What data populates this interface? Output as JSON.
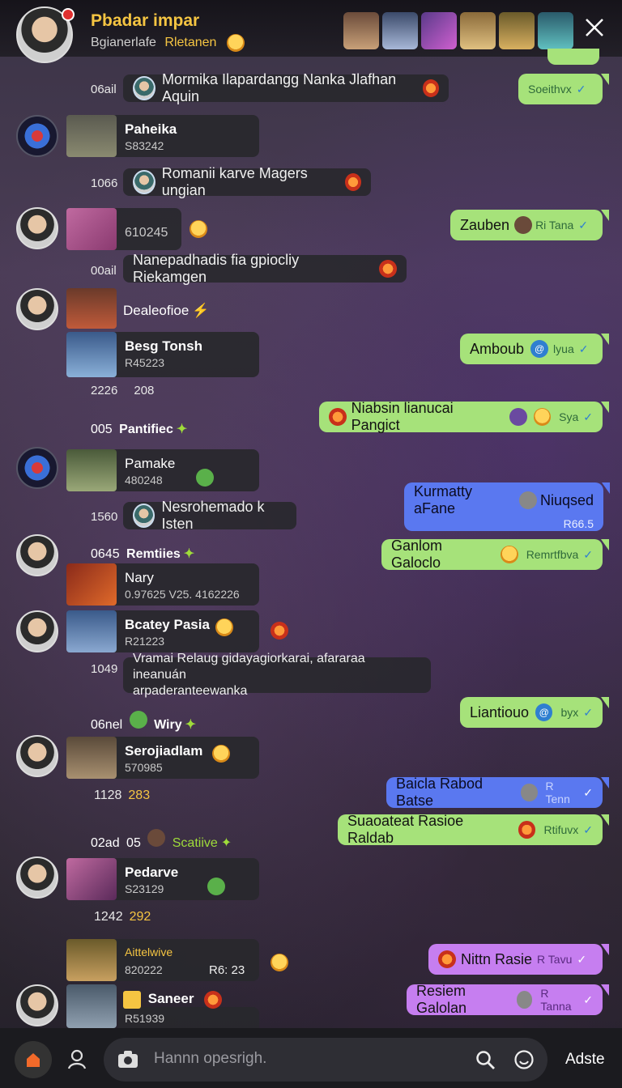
{
  "header": {
    "title": "Pbadar impar",
    "subtitle": "Bgianerlafe",
    "subtitle_highlight": "Rletanen",
    "close_icon": "close-icon"
  },
  "messages": {
    "m1": {
      "time": "06ail",
      "text": "Mormika Ilapardangg Nanka Jlafhan Aquin"
    },
    "m1r": {
      "text": "Soeithvx"
    },
    "c1": {
      "name": "Paheika",
      "sub": "S83242"
    },
    "m2": {
      "time": "1066",
      "text": "Romanii karve Magers ungian"
    },
    "c2": {
      "sub": "610245"
    },
    "m2r": {
      "text": "Zauben",
      "meta": "Ri Tana"
    },
    "m3": {
      "time": "00ail",
      "text": "Nanepadhadis fia gpiocliy Riekamgen"
    },
    "l1": {
      "text": "Dealeofioe"
    },
    "c3": {
      "name": "Besg Tonsh",
      "sub": "R45223"
    },
    "m3r": {
      "text": "Amboub",
      "meta": "lyua"
    },
    "c3n": {
      "a": "2226",
      "b": "208"
    },
    "m4r": {
      "text": "Niabsin lianucai Pangict",
      "meta": "Sya"
    },
    "l2": {
      "time": "005",
      "text": "Pantifiec"
    },
    "c4": {
      "name": "Pamake",
      "sub": "480248"
    },
    "m5r": {
      "text": "Kurmatty aFane",
      "text2": "Niuqsed",
      "meta": "R66.5"
    },
    "m5": {
      "time": "1560",
      "text": "Nesrohemado k Isten"
    },
    "l3": {
      "time": "0645",
      "text": "Remtiies"
    },
    "m6r": {
      "text": "Ganlom Galoclo",
      "meta": "Remrtfbva"
    },
    "c5": {
      "name": "Nary",
      "sub": "0.97625 V25. 4162226"
    },
    "c6": {
      "name": "Bcatey Pasia",
      "sub": "R21223"
    },
    "m7": {
      "time": "1049",
      "text": "Vramai Relaug gidayagiorkarai, afararaa ineanuán",
      "text2": "arpaderanteewanka"
    },
    "l4": {
      "time": "06nel",
      "text": "Wiry"
    },
    "m8r": {
      "text": "Liantiouo",
      "meta": "byx"
    },
    "c7": {
      "name": "Serojiadlam",
      "sub": "570985"
    },
    "c7n": {
      "a": "1128",
      "b": "283"
    },
    "m9r": {
      "text": "Baicla Rabod Batse",
      "meta": "R Tenn"
    },
    "l5": {
      "time": "02ad",
      "num": "05",
      "text": "Scatiive"
    },
    "m10r": {
      "text": "Suaoateat Rasioe Raldab",
      "meta": "Rtifuvx"
    },
    "c8": {
      "name": "Pedarve",
      "sub": "S23129"
    },
    "c8n": {
      "a": "1242",
      "b": "292"
    },
    "c9": {
      "name": "Aittelwive",
      "sub": "820222",
      "sub2": "R6: 23"
    },
    "m11r": {
      "text": "Nittn Rasie",
      "meta": "R Tavu"
    },
    "c10": {
      "name": "Saneer",
      "sub": "R51939"
    },
    "m12r": {
      "text": "Resiem Galolan",
      "meta": "R Tanna"
    }
  },
  "composer": {
    "placeholder": "Hannn opesrigh.",
    "send_label": "Adste"
  },
  "colors": {
    "green_bubble": "#a6e27a",
    "blue_bubble": "#5a78f0",
    "purple_bubble": "#c67ef0",
    "accent": "#f5c542"
  }
}
